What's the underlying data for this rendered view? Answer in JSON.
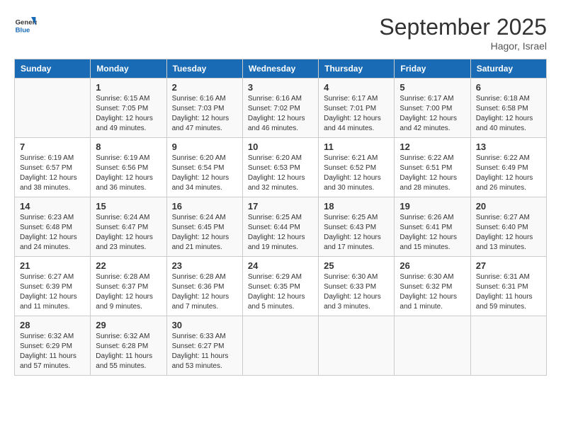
{
  "header": {
    "logo_general": "General",
    "logo_blue": "Blue",
    "month_year": "September 2025",
    "location": "Hagor, Israel"
  },
  "days_of_week": [
    "Sunday",
    "Monday",
    "Tuesday",
    "Wednesday",
    "Thursday",
    "Friday",
    "Saturday"
  ],
  "weeks": [
    [
      {
        "day": "",
        "info": ""
      },
      {
        "day": "1",
        "info": "Sunrise: 6:15 AM\nSunset: 7:05 PM\nDaylight: 12 hours\nand 49 minutes."
      },
      {
        "day": "2",
        "info": "Sunrise: 6:16 AM\nSunset: 7:03 PM\nDaylight: 12 hours\nand 47 minutes."
      },
      {
        "day": "3",
        "info": "Sunrise: 6:16 AM\nSunset: 7:02 PM\nDaylight: 12 hours\nand 46 minutes."
      },
      {
        "day": "4",
        "info": "Sunrise: 6:17 AM\nSunset: 7:01 PM\nDaylight: 12 hours\nand 44 minutes."
      },
      {
        "day": "5",
        "info": "Sunrise: 6:17 AM\nSunset: 7:00 PM\nDaylight: 12 hours\nand 42 minutes."
      },
      {
        "day": "6",
        "info": "Sunrise: 6:18 AM\nSunset: 6:58 PM\nDaylight: 12 hours\nand 40 minutes."
      }
    ],
    [
      {
        "day": "7",
        "info": "Sunrise: 6:19 AM\nSunset: 6:57 PM\nDaylight: 12 hours\nand 38 minutes."
      },
      {
        "day": "8",
        "info": "Sunrise: 6:19 AM\nSunset: 6:56 PM\nDaylight: 12 hours\nand 36 minutes."
      },
      {
        "day": "9",
        "info": "Sunrise: 6:20 AM\nSunset: 6:54 PM\nDaylight: 12 hours\nand 34 minutes."
      },
      {
        "day": "10",
        "info": "Sunrise: 6:20 AM\nSunset: 6:53 PM\nDaylight: 12 hours\nand 32 minutes."
      },
      {
        "day": "11",
        "info": "Sunrise: 6:21 AM\nSunset: 6:52 PM\nDaylight: 12 hours\nand 30 minutes."
      },
      {
        "day": "12",
        "info": "Sunrise: 6:22 AM\nSunset: 6:51 PM\nDaylight: 12 hours\nand 28 minutes."
      },
      {
        "day": "13",
        "info": "Sunrise: 6:22 AM\nSunset: 6:49 PM\nDaylight: 12 hours\nand 26 minutes."
      }
    ],
    [
      {
        "day": "14",
        "info": "Sunrise: 6:23 AM\nSunset: 6:48 PM\nDaylight: 12 hours\nand 24 minutes."
      },
      {
        "day": "15",
        "info": "Sunrise: 6:24 AM\nSunset: 6:47 PM\nDaylight: 12 hours\nand 23 minutes."
      },
      {
        "day": "16",
        "info": "Sunrise: 6:24 AM\nSunset: 6:45 PM\nDaylight: 12 hours\nand 21 minutes."
      },
      {
        "day": "17",
        "info": "Sunrise: 6:25 AM\nSunset: 6:44 PM\nDaylight: 12 hours\nand 19 minutes."
      },
      {
        "day": "18",
        "info": "Sunrise: 6:25 AM\nSunset: 6:43 PM\nDaylight: 12 hours\nand 17 minutes."
      },
      {
        "day": "19",
        "info": "Sunrise: 6:26 AM\nSunset: 6:41 PM\nDaylight: 12 hours\nand 15 minutes."
      },
      {
        "day": "20",
        "info": "Sunrise: 6:27 AM\nSunset: 6:40 PM\nDaylight: 12 hours\nand 13 minutes."
      }
    ],
    [
      {
        "day": "21",
        "info": "Sunrise: 6:27 AM\nSunset: 6:39 PM\nDaylight: 12 hours\nand 11 minutes."
      },
      {
        "day": "22",
        "info": "Sunrise: 6:28 AM\nSunset: 6:37 PM\nDaylight: 12 hours\nand 9 minutes."
      },
      {
        "day": "23",
        "info": "Sunrise: 6:28 AM\nSunset: 6:36 PM\nDaylight: 12 hours\nand 7 minutes."
      },
      {
        "day": "24",
        "info": "Sunrise: 6:29 AM\nSunset: 6:35 PM\nDaylight: 12 hours\nand 5 minutes."
      },
      {
        "day": "25",
        "info": "Sunrise: 6:30 AM\nSunset: 6:33 PM\nDaylight: 12 hours\nand 3 minutes."
      },
      {
        "day": "26",
        "info": "Sunrise: 6:30 AM\nSunset: 6:32 PM\nDaylight: 12 hours\nand 1 minute."
      },
      {
        "day": "27",
        "info": "Sunrise: 6:31 AM\nSunset: 6:31 PM\nDaylight: 11 hours\nand 59 minutes."
      }
    ],
    [
      {
        "day": "28",
        "info": "Sunrise: 6:32 AM\nSunset: 6:29 PM\nDaylight: 11 hours\nand 57 minutes."
      },
      {
        "day": "29",
        "info": "Sunrise: 6:32 AM\nSunset: 6:28 PM\nDaylight: 11 hours\nand 55 minutes."
      },
      {
        "day": "30",
        "info": "Sunrise: 6:33 AM\nSunset: 6:27 PM\nDaylight: 11 hours\nand 53 minutes."
      },
      {
        "day": "",
        "info": ""
      },
      {
        "day": "",
        "info": ""
      },
      {
        "day": "",
        "info": ""
      },
      {
        "day": "",
        "info": ""
      }
    ]
  ]
}
